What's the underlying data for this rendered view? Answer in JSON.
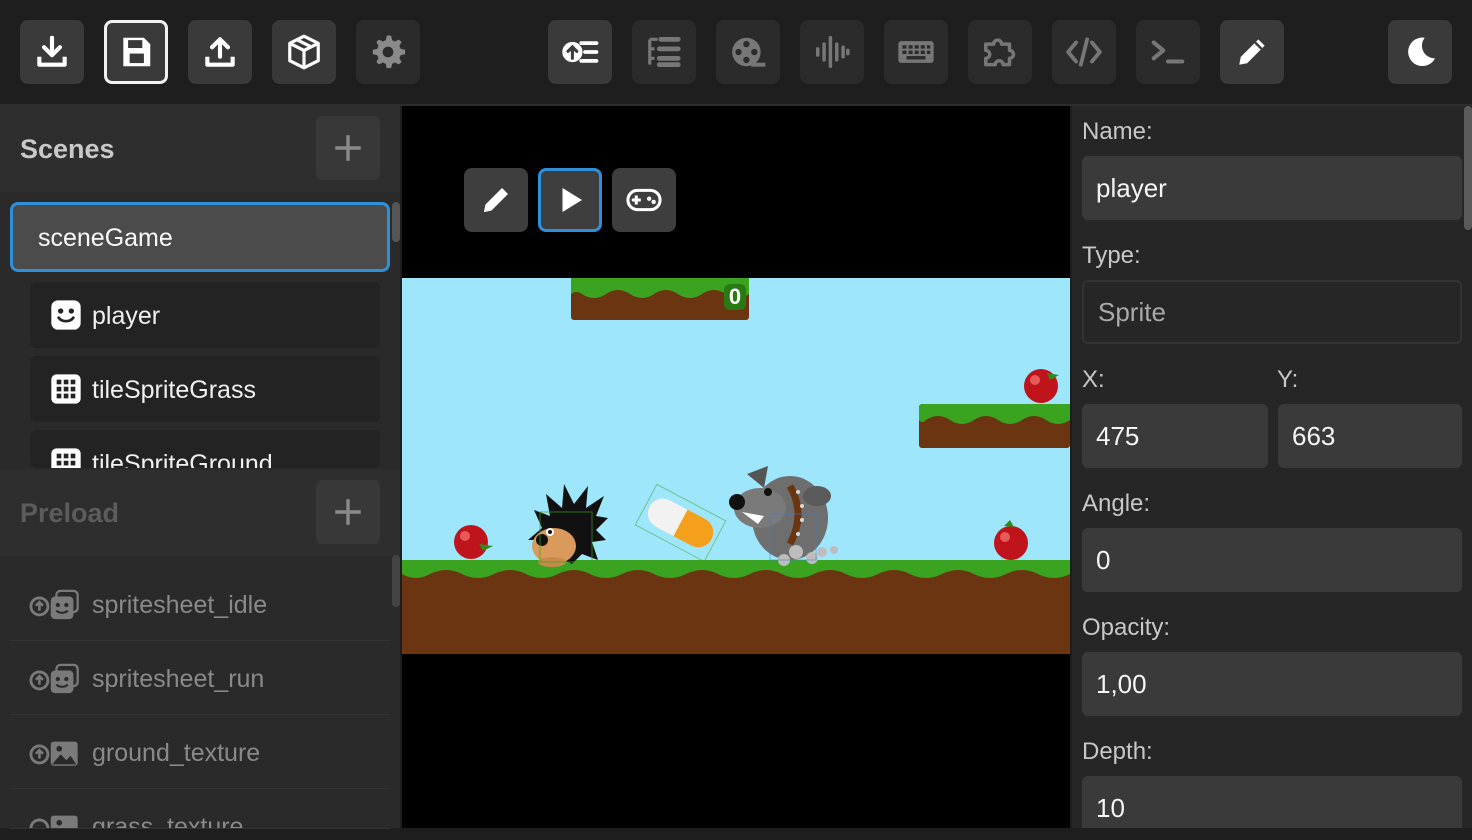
{
  "toolbar": {
    "left_buttons": [
      "download-icon",
      "save-icon",
      "upload-icon",
      "package-icon",
      "gear-icon"
    ],
    "center_buttons": [
      "preload-assets-icon",
      "tree-list-icon",
      "film-reel-icon",
      "audio-wave-icon",
      "keyboard-icon",
      "puzzle-icon",
      "code-icon",
      "terminal-icon",
      "pencil-icon"
    ],
    "right_buttons": [
      "moon-icon"
    ]
  },
  "scenes": {
    "title": "Scenes",
    "active_scene": "sceneGame",
    "objects": [
      {
        "label": "player",
        "icon": "smiley-icon"
      },
      {
        "label": "tileSpriteGrass",
        "icon": "grid-icon"
      },
      {
        "label": "tileSpriteGround",
        "icon": "grid-icon"
      }
    ]
  },
  "preload": {
    "title": "Preload",
    "items": [
      {
        "label": "spritesheet_idle",
        "icon": "spritesheet-icon"
      },
      {
        "label": "spritesheet_run",
        "icon": "spritesheet-icon"
      },
      {
        "label": "ground_texture",
        "icon": "image-icon"
      },
      {
        "label": "grass_texture",
        "icon": "image-icon"
      }
    ]
  },
  "canvas": {
    "mode_buttons": [
      "pencil-icon",
      "play-icon",
      "gamepad-icon"
    ],
    "active_mode": "play",
    "score": "0"
  },
  "properties": {
    "name_label": "Name:",
    "name_value": "player",
    "type_label": "Type:",
    "type_value": "Sprite",
    "x_label": "X:",
    "x_value": "475",
    "y_label": "Y:",
    "y_value": "663",
    "angle_label": "Angle:",
    "angle_value": "0",
    "opacity_label": "Opacity:",
    "opacity_value": "1,00",
    "depth_label": "Depth:",
    "depth_value": "10"
  },
  "colors": {
    "accent": "#2f8fd8",
    "sky": "#9ee6fb",
    "grass": "#3aa31f",
    "dirt": "#6b3512",
    "panel": "#2a2a2a"
  }
}
